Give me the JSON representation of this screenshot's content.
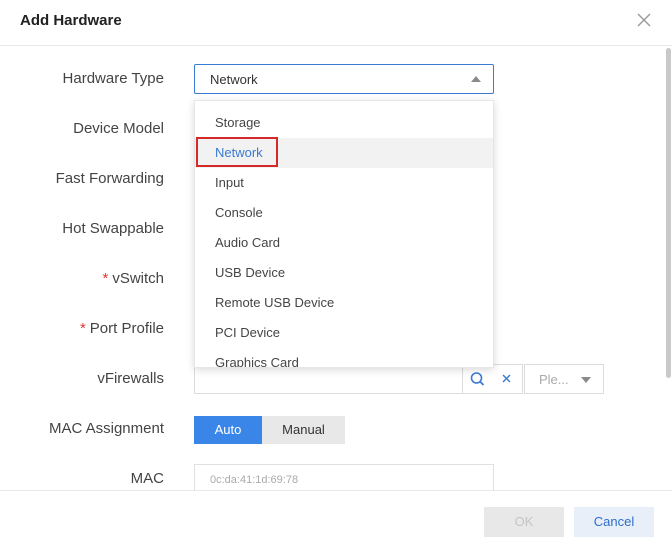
{
  "dialog": {
    "title": "Add Hardware",
    "close_icon": "close-icon"
  },
  "form": {
    "labels": {
      "hardware_type": "Hardware Type",
      "device_model": "Device Model",
      "fast_forwarding": "Fast Forwarding",
      "hot_swappable": "Hot Swappable",
      "vswitch": "vSwitch",
      "port_profile": "Port Profile",
      "vfirewalls": "vFirewalls",
      "mac_assignment": "MAC Assignment",
      "mac": "MAC"
    },
    "required_mark": "*",
    "hardware_type_value": "Network",
    "hardware_type_options": [
      "Storage",
      "Network",
      "Input",
      "Console",
      "Audio Card",
      "USB Device",
      "Remote USB Device",
      "PCI Device",
      "Graphics Card"
    ],
    "vfirewalls_select_placeholder": "Ple...",
    "mac_assignment": {
      "auto": "Auto",
      "manual": "Manual",
      "selected": "Auto"
    },
    "mac_value": "0c:da:41:1d:69:78"
  },
  "footer": {
    "ok": "OK",
    "cancel": "Cancel"
  },
  "colors": {
    "accent": "#3a86e8",
    "highlight_box": "#d62828",
    "required": "#e53935"
  }
}
